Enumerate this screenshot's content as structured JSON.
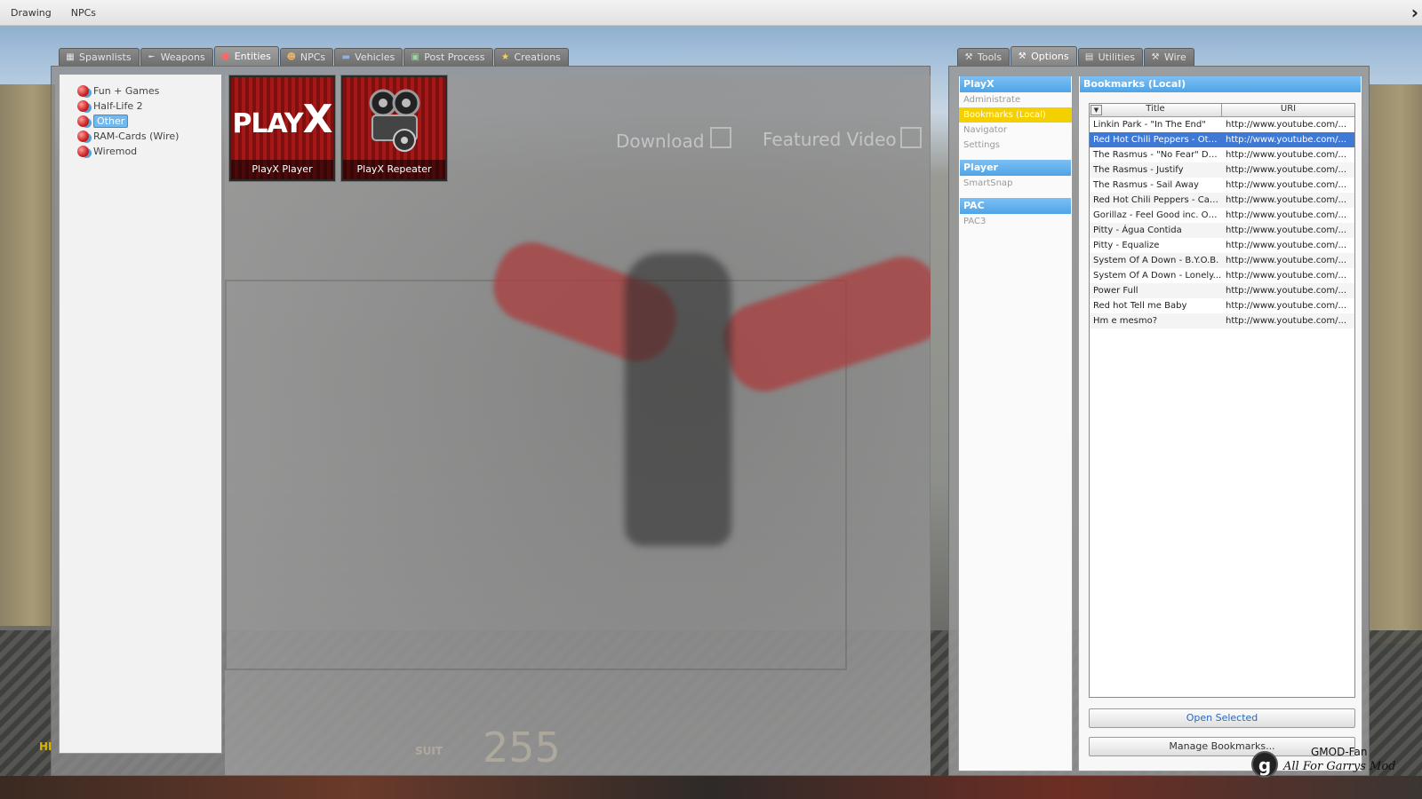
{
  "menubar": {
    "items": [
      "Drawing",
      "NPCs"
    ]
  },
  "spawn_tabs": [
    {
      "label": "Spawnlists",
      "icon": "grid-icon",
      "active": false
    },
    {
      "label": "Weapons",
      "icon": "gun-icon",
      "active": false
    },
    {
      "label": "Entities",
      "icon": "entity-ball-icon",
      "active": true
    },
    {
      "label": "NPCs",
      "icon": "npc-face-icon",
      "active": false
    },
    {
      "label": "Vehicles",
      "icon": "car-icon",
      "active": false
    },
    {
      "label": "Post Process",
      "icon": "image-icon",
      "active": false
    },
    {
      "label": "Creations",
      "icon": "star-icon",
      "active": false
    }
  ],
  "tree": [
    {
      "label": "Fun + Games",
      "selected": false
    },
    {
      "label": "Half-Life 2",
      "selected": false
    },
    {
      "label": "Other",
      "selected": true
    },
    {
      "label": "RAM-Cards (Wire)",
      "selected": false
    },
    {
      "label": "Wiremod",
      "selected": false
    }
  ],
  "spawn_icons": [
    {
      "label": "PlayX Player",
      "art_text": "PLAYX"
    },
    {
      "label": "PlayX Repeater",
      "art_text": ""
    }
  ],
  "scene": {
    "download": "Download",
    "featured": "Featured Video",
    "hud_suit": "SUIT",
    "hud_value": "255",
    "hud_left": "HI"
  },
  "context_tabs": [
    {
      "label": "Tools",
      "icon": "wrench-icon",
      "active": false
    },
    {
      "label": "Options",
      "icon": "wrench-icon",
      "active": true
    },
    {
      "label": "Utilities",
      "icon": "document-icon",
      "active": false
    },
    {
      "label": "Wire",
      "icon": "wrench-icon",
      "active": false
    }
  ],
  "categories": {
    "playx": {
      "header": "PlayX",
      "items": [
        "Administrate",
        "Bookmarks (Local)",
        "Navigator",
        "Settings"
      ],
      "selected_index": 1
    },
    "player": {
      "header": "Player",
      "items": [
        "SmartSnap"
      ]
    },
    "pac": {
      "header": "PAC",
      "items": [
        "PAC3"
      ]
    }
  },
  "bookmarks": {
    "title": "Bookmarks (Local)",
    "columns": [
      "Title",
      "URI"
    ],
    "rows": [
      {
        "title": "Linkin Park - \"In The End\"",
        "uri": "http://www.youtube.com/..."
      },
      {
        "title": "Red Hot Chili Peppers - Oth...",
        "uri": "http://www.youtube.com/...",
        "selected": true
      },
      {
        "title": "The Rasmus - \"No Fear\" DR...",
        "uri": "http://www.youtube.com/..."
      },
      {
        "title": "The Rasmus - Justify",
        "uri": "http://www.youtube.com/..."
      },
      {
        "title": "The Rasmus - Sail Away",
        "uri": "http://www.youtube.com/..."
      },
      {
        "title": "Red Hot Chili Peppers - Can...",
        "uri": "http://www.youtube.com/..."
      },
      {
        "title": "Gorillaz - Feel Good inc. Offi...",
        "uri": "http://www.youtube.com/..."
      },
      {
        "title": "Pitty - Água Contida",
        "uri": "http://www.youtube.com/..."
      },
      {
        "title": "Pitty - Equalize",
        "uri": "http://www.youtube.com/..."
      },
      {
        "title": "System Of A Down - B.Y.O.B.",
        "uri": "http://www.youtube.com/..."
      },
      {
        "title": "System Of A Down - Lonely...",
        "uri": "http://www.youtube.com/..."
      },
      {
        "title": "Power Full",
        "uri": "http://www.youtube.com/..."
      },
      {
        "title": "Red hot Tell me Baby",
        "uri": "http://www.youtube.com/..."
      },
      {
        "title": "Hm e mesmo?",
        "uri": "http://www.youtube.com/..."
      }
    ],
    "open_selected": "Open Selected",
    "manage": "Manage Bookmarks..."
  },
  "watermark": {
    "line1": "GMOD-Fan",
    "line2": "All For Garrys Mod",
    "logo": "g"
  },
  "colors": {
    "accent": "#4ea4e6",
    "selection": "#3f79d6",
    "category_selected": "#f5d000"
  }
}
